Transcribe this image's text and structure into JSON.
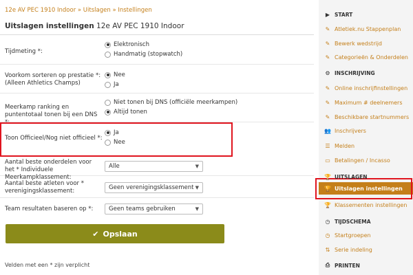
{
  "breadcrumb": {
    "items": [
      "12e AV PEC 1910 Indoor",
      "Uitslagen",
      "Instellingen"
    ],
    "separator": "»"
  },
  "form": {
    "title_bold": "Uitslagen instellingen",
    "title_rest": " 12e AV PEC 1910 Indoor",
    "tijdmeting": {
      "label": "Tijdmeting *:",
      "options": [
        "Elektronisch",
        "Handmatig (stopwatch)"
      ],
      "selected": 0
    },
    "voorkom": {
      "label": "Voorkom sorteren op prestatie *: (Alleen Athletics Champs)",
      "options": [
        "Nee",
        "Ja"
      ],
      "selected": 0
    },
    "meerkamp": {
      "label": "Meerkamp ranking en puntentotaal tonen bij een DNS *:",
      "options": [
        "Niet tonen bij DNS (officiële meerkampen)",
        "Altijd tonen"
      ],
      "selected": 1
    },
    "officieel": {
      "label": "Toon Officieel/Nog niet officieel *:",
      "options": [
        "Ja",
        "Nee"
      ],
      "selected": 0
    },
    "onderdelen": {
      "label": "Aantal beste onderdelen voor het * Individuele Meerkampklassement:",
      "value": "Alle"
    },
    "atleten": {
      "label": "Aantal beste atleten voor * verenigingsklassement:",
      "value": "Geen verenigingsklassement"
    },
    "teams": {
      "label": "Team resultaten baseren op *:",
      "value": "Geen teams gebruiken"
    },
    "save_label": "Opslaan",
    "footnote": "Velden met een * zijn verplicht"
  },
  "sidebar": {
    "sections": [
      {
        "type": "head",
        "icon": "play-icon",
        "glyph": "▶",
        "label": "START"
      },
      {
        "type": "link",
        "icon": "edit-icon",
        "glyph": "✎",
        "label": "Atletiek.nu Stappenplan"
      },
      {
        "type": "link",
        "icon": "edit-icon",
        "glyph": "✎",
        "label": "Bewerk wedstrijd"
      },
      {
        "type": "link",
        "icon": "edit-icon",
        "glyph": "✎",
        "label": "Categorieën & Onderdelen"
      },
      {
        "type": "head",
        "icon": "gears-icon",
        "glyph": "⚙",
        "label": "INSCHRIJVING"
      },
      {
        "type": "link",
        "icon": "edit-icon",
        "glyph": "✎",
        "label": "Online inschrijfinstellingen"
      },
      {
        "type": "link",
        "icon": "edit-icon",
        "glyph": "✎",
        "label": "Maximum # deelnemers"
      },
      {
        "type": "link",
        "icon": "edit-icon",
        "glyph": "✎",
        "label": "Beschikbare startnummers"
      },
      {
        "type": "link",
        "icon": "users-icon",
        "glyph": "👥",
        "label": "Inschrijvers"
      },
      {
        "type": "link",
        "icon": "list-icon",
        "glyph": "☰",
        "label": "Melden"
      },
      {
        "type": "link",
        "icon": "credit-card-icon",
        "glyph": "▭",
        "label": "Betalingen / Incasso"
      },
      {
        "type": "head",
        "icon": "trophy-icon",
        "glyph": "🏆",
        "label": "UITSLAGEN"
      },
      {
        "type": "active",
        "icon": "trophy-icon",
        "glyph": "🏆",
        "label": "Uitslagen instellingen"
      },
      {
        "type": "link",
        "icon": "trophy-icon",
        "glyph": "🏆",
        "label": "Klassementen instellingen"
      },
      {
        "type": "head",
        "icon": "clock-icon",
        "glyph": "◷",
        "label": "TIJDSCHEMA"
      },
      {
        "type": "link",
        "icon": "clock-icon",
        "glyph": "◷",
        "label": "Startgroepen"
      },
      {
        "type": "link",
        "icon": "sort-icon",
        "glyph": "⇅",
        "label": "Serie indeling"
      },
      {
        "type": "head",
        "icon": "print-icon",
        "glyph": "⎙",
        "label": "PRINTEN"
      }
    ]
  },
  "colors": {
    "accent": "#c47f1a",
    "save_button": "#8b8b1a",
    "highlight": "#e0141e"
  }
}
